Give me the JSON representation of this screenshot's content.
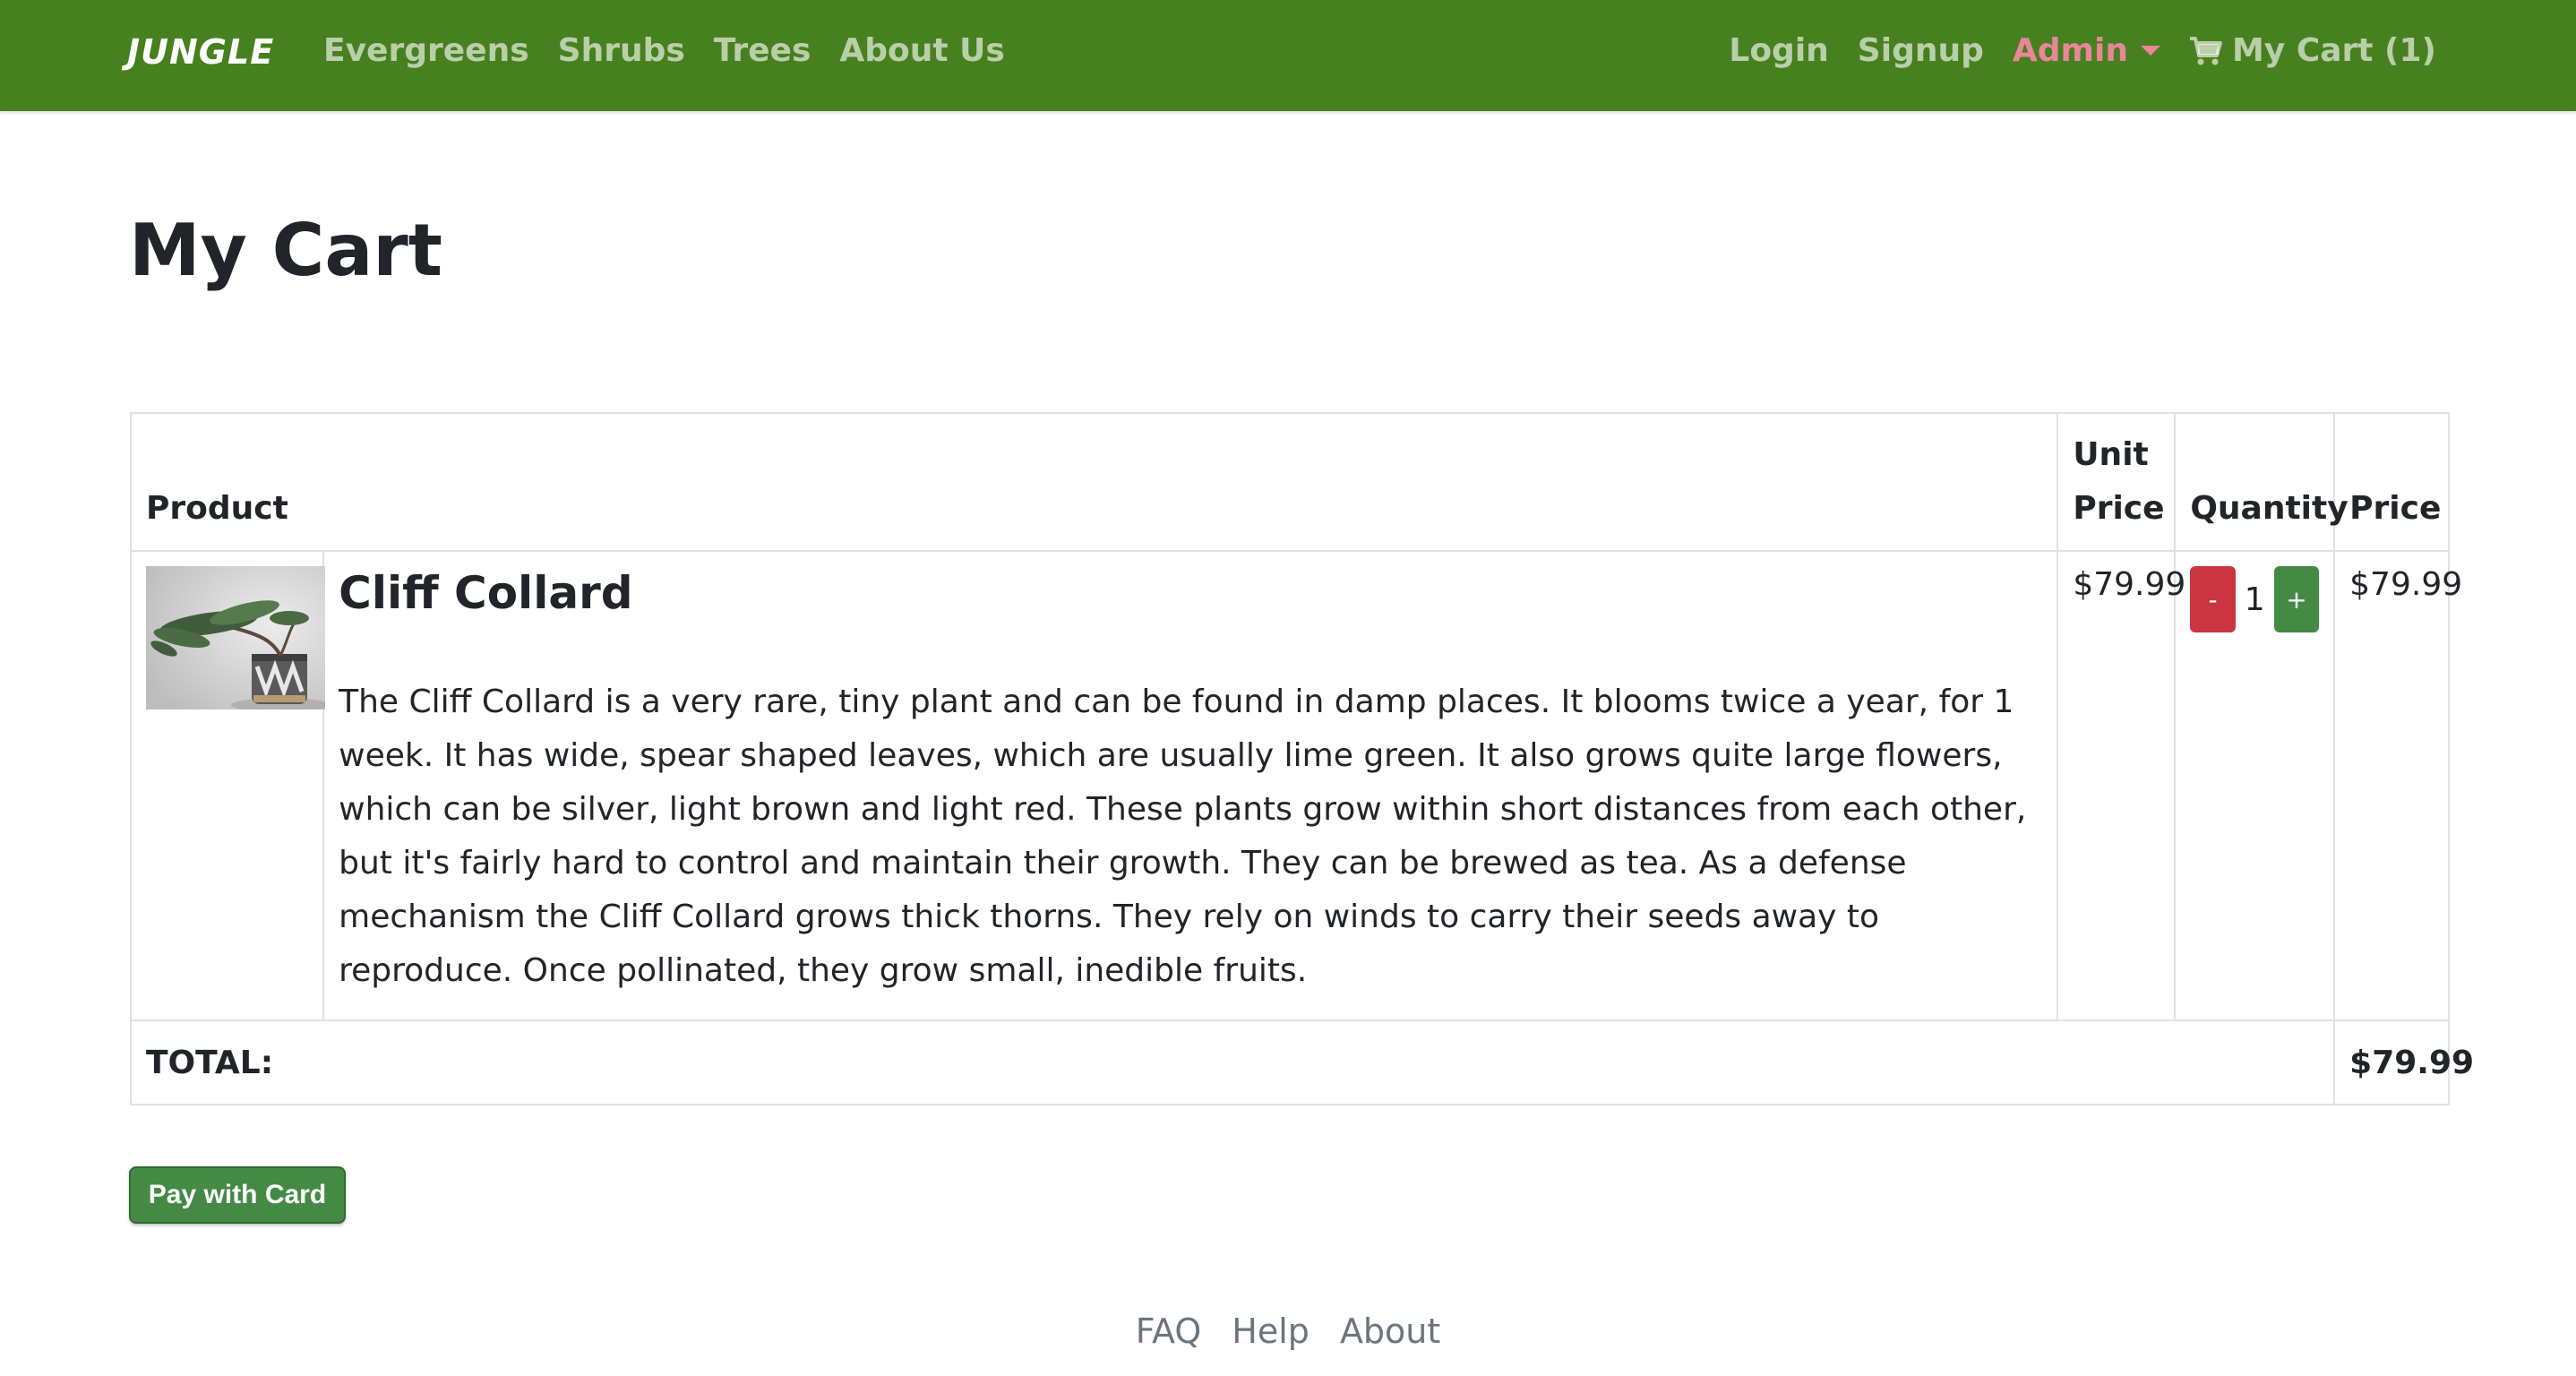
{
  "navbar": {
    "brand": "JUNGLE",
    "links": [
      "Evergreens",
      "Shrubs",
      "Trees",
      "About Us"
    ],
    "login": "Login",
    "signup": "Signup",
    "admin": "Admin",
    "cart": "My Cart (1)",
    "colors": {
      "background": "#47801f",
      "admin": "#e8869a"
    }
  },
  "page": {
    "title": "My Cart"
  },
  "table": {
    "headers": {
      "product": "Product",
      "unit_price": "Unit Price",
      "quantity": "Quantity",
      "price": "Price"
    },
    "items": [
      {
        "name": "Cliff Collard",
        "description": "The Cliff Collard is a very rare, tiny plant and can be found in damp places. It blooms twice a year, for 1 week. It has wide, spear shaped leaves, which are usually lime green. It also grows quite large flowers, which can be silver, light brown and light red. These plants grow within short distances from each other, but it's fairly hard to control and maintain their growth. They can be brewed as tea. As a defense mechanism the Cliff Collard grows thick thorns. They rely on winds to carry their seeds away to reproduce. Once pollinated, they grow small, inedible fruits.",
        "unit_price": "$79.99",
        "quantity": "1",
        "price": "$79.99",
        "minus_label": "-",
        "plus_label": "+"
      }
    ],
    "total_label": "TOTAL:",
    "total_value": "$79.99"
  },
  "actions": {
    "pay": "Pay with Card"
  },
  "footer": {
    "links": [
      "FAQ",
      "Help",
      "About"
    ]
  }
}
